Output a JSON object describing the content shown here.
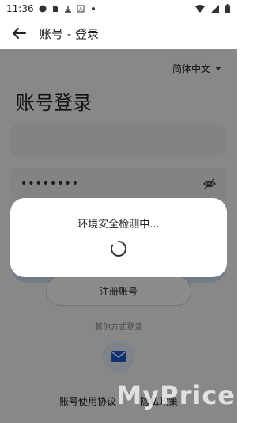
{
  "status": {
    "time": "11:36",
    "icons": [
      "messenger-icon",
      "sim-icon",
      "download-icon",
      "a-icon",
      "dot-icon"
    ]
  },
  "appbar": {
    "title": "账号 - 登录"
  },
  "login": {
    "language": "简体中文",
    "heading": "账号登录",
    "account_value": "",
    "password_masked": "••••••••",
    "register_label": "注册账号",
    "other_methods_label": "其他方式登录",
    "links": [
      "账号使用协议",
      "隐私政策"
    ]
  },
  "dialog": {
    "message": "环境安全检测中..."
  },
  "watermark": {
    "text": "MyPrice"
  }
}
